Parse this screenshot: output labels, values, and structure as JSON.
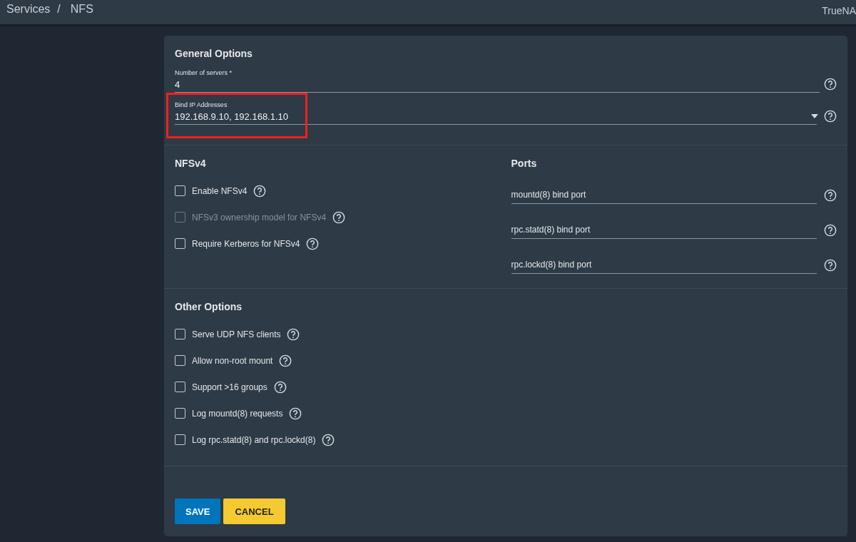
{
  "breadcrumb": {
    "items": [
      "Services",
      "NFS"
    ],
    "separator": "/"
  },
  "brand": "TrueNA",
  "general": {
    "title": "General Options",
    "fields": [
      {
        "kind": "input",
        "label": "Number of servers *",
        "value": "4",
        "highlighted": false
      },
      {
        "kind": "select",
        "label": "Bind IP Addresses",
        "value": "192.168.9.10, 192.168.1.10",
        "highlighted": true
      }
    ]
  },
  "nfsv4": {
    "title": "NFSv4",
    "options": [
      {
        "label": "Enable NFSv4",
        "checked": false,
        "disabled": false
      },
      {
        "label": "NFSv3 ownership model for NFSv4",
        "checked": false,
        "disabled": true
      },
      {
        "label": "Require Kerberos for NFSv4",
        "checked": false,
        "disabled": false
      }
    ]
  },
  "ports": {
    "title": "Ports",
    "fields": [
      {
        "placeholder": "mountd(8) bind port"
      },
      {
        "placeholder": "rpc.statd(8) bind port"
      },
      {
        "placeholder": "rpc.lockd(8) bind port"
      }
    ]
  },
  "other": {
    "title": "Other Options",
    "options": [
      {
        "label": "Serve UDP NFS clients",
        "checked": false,
        "disabled": false
      },
      {
        "label": "Allow non-root mount",
        "checked": false,
        "disabled": false
      },
      {
        "label": "Support >16 groups",
        "checked": false,
        "disabled": false
      },
      {
        "label": "Log mountd(8) requests",
        "checked": false,
        "disabled": false
      },
      {
        "label": "Log rpc.statd(8) and rpc.lockd(8)",
        "checked": false,
        "disabled": false
      }
    ]
  },
  "buttons": [
    {
      "label": "SAVE",
      "kind": "primary"
    },
    {
      "label": "CANCEL",
      "kind": "accent"
    }
  ]
}
